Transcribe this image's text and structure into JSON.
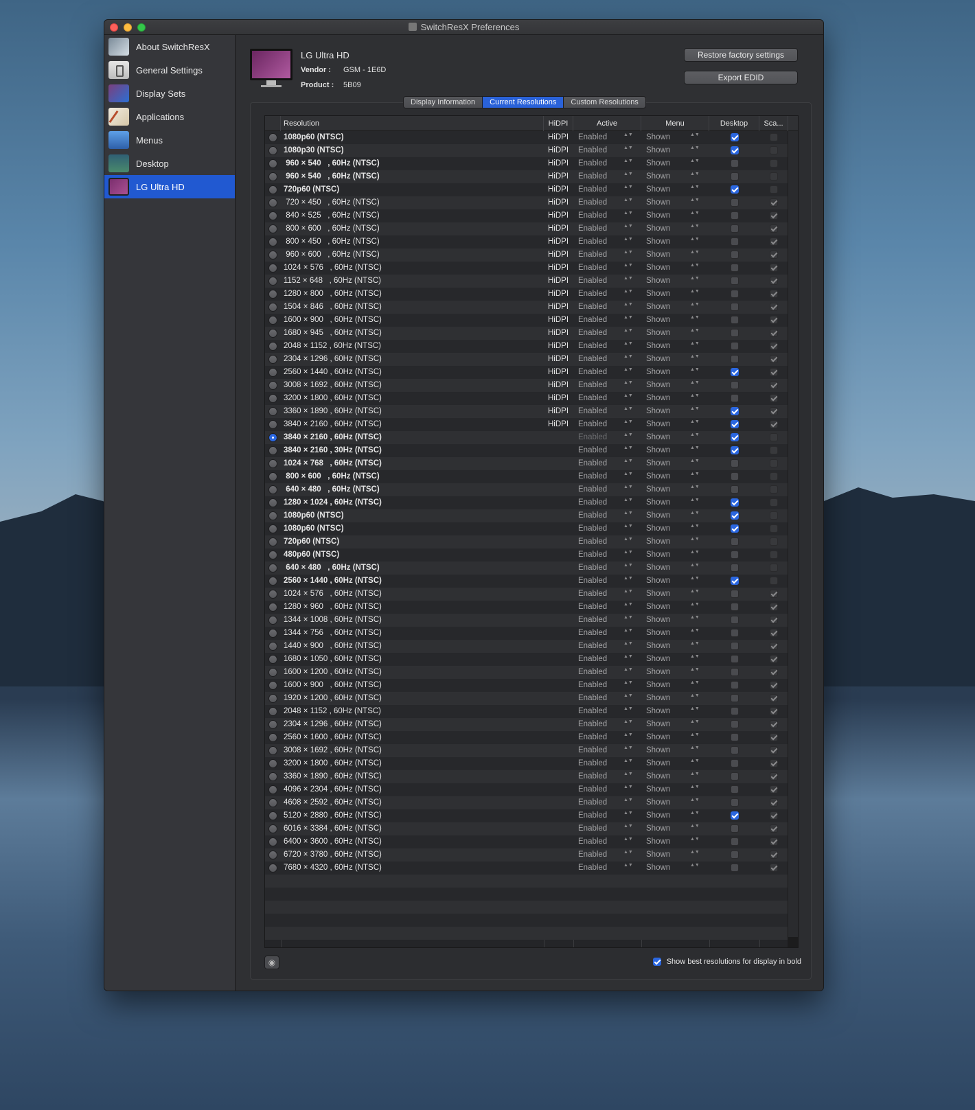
{
  "window": {
    "title": "SwitchResX Preferences"
  },
  "sidebar": {
    "items": [
      {
        "label": "About SwitchResX",
        "icon": "about-icon"
      },
      {
        "label": "General Settings",
        "icon": "general-settings-icon"
      },
      {
        "label": "Display Sets",
        "icon": "display-sets-icon"
      },
      {
        "label": "Applications",
        "icon": "applications-icon"
      },
      {
        "label": "Menus",
        "icon": "menus-icon"
      },
      {
        "label": "Desktop",
        "icon": "desktop-icon"
      },
      {
        "label": "LG Ultra HD",
        "icon": "lg-monitor-icon",
        "selected": true
      }
    ]
  },
  "display": {
    "name": "LG Ultra HD",
    "vendor_label": "Vendor :",
    "vendor": "GSM - 1E6D",
    "product_label": "Product :",
    "product": "5B09"
  },
  "buttons": {
    "restore": "Restore factory settings",
    "export": "Export EDID"
  },
  "tabs": [
    {
      "label": "Display Information",
      "active": false
    },
    {
      "label": "Current Resolutions",
      "active": true
    },
    {
      "label": "Custom Resolutions",
      "active": false
    }
  ],
  "table": {
    "headers": {
      "resolution": "Resolution",
      "hidpi": "HiDPI",
      "active": "Active",
      "menu": "Menu",
      "desktop": "Desktop",
      "scaled": "Sca..."
    },
    "rows": [
      {
        "res": "1080p60 (NTSC)",
        "bold": true,
        "hidpi": "HiDPI",
        "desktop": true,
        "scaled": false
      },
      {
        "res": "1080p30 (NTSC)",
        "bold": true,
        "hidpi": "HiDPI",
        "desktop": true,
        "scaled": false
      },
      {
        "res": " 960 × 540   , 60Hz (NTSC)",
        "bold": true,
        "hidpi": "HiDPI",
        "desktop": false,
        "scaled": false
      },
      {
        "res": " 960 × 540   , 60Hz (NTSC)",
        "bold": true,
        "hidpi": "HiDPI",
        "desktop": false,
        "scaled": false
      },
      {
        "res": "720p60 (NTSC)",
        "bold": true,
        "hidpi": "HiDPI",
        "desktop": true,
        "scaled": false
      },
      {
        "res": " 720 × 450   , 60Hz (NTSC)",
        "bold": false,
        "hidpi": "HiDPI",
        "desktop": false,
        "scaled": true
      },
      {
        "res": " 840 × 525   , 60Hz (NTSC)",
        "bold": false,
        "hidpi": "HiDPI",
        "desktop": false,
        "scaled": true
      },
      {
        "res": " 800 × 600   , 60Hz (NTSC)",
        "bold": false,
        "hidpi": "HiDPI",
        "desktop": false,
        "scaled": true
      },
      {
        "res": " 800 × 450   , 60Hz (NTSC)",
        "bold": false,
        "hidpi": "HiDPI",
        "desktop": false,
        "scaled": true
      },
      {
        "res": " 960 × 600   , 60Hz (NTSC)",
        "bold": false,
        "hidpi": "HiDPI",
        "desktop": false,
        "scaled": true
      },
      {
        "res": "1024 × 576   , 60Hz (NTSC)",
        "bold": false,
        "hidpi": "HiDPI",
        "desktop": false,
        "scaled": true
      },
      {
        "res": "1152 × 648   , 60Hz (NTSC)",
        "bold": false,
        "hidpi": "HiDPI",
        "desktop": false,
        "scaled": true
      },
      {
        "res": "1280 × 800   , 60Hz (NTSC)",
        "bold": false,
        "hidpi": "HiDPI",
        "desktop": false,
        "scaled": true
      },
      {
        "res": "1504 × 846   , 60Hz (NTSC)",
        "bold": false,
        "hidpi": "HiDPI",
        "desktop": false,
        "scaled": true
      },
      {
        "res": "1600 × 900   , 60Hz (NTSC)",
        "bold": false,
        "hidpi": "HiDPI",
        "desktop": false,
        "scaled": true
      },
      {
        "res": "1680 × 945   , 60Hz (NTSC)",
        "bold": false,
        "hidpi": "HiDPI",
        "desktop": false,
        "scaled": true
      },
      {
        "res": "2048 × 1152 , 60Hz (NTSC)",
        "bold": false,
        "hidpi": "HiDPI",
        "desktop": false,
        "scaled": true
      },
      {
        "res": "2304 × 1296 , 60Hz (NTSC)",
        "bold": false,
        "hidpi": "HiDPI",
        "desktop": false,
        "scaled": true
      },
      {
        "res": "2560 × 1440 , 60Hz (NTSC)",
        "bold": false,
        "hidpi": "HiDPI",
        "desktop": true,
        "scaled": true
      },
      {
        "res": "3008 × 1692 , 60Hz (NTSC)",
        "bold": false,
        "hidpi": "HiDPI",
        "desktop": false,
        "scaled": true
      },
      {
        "res": "3200 × 1800 , 60Hz (NTSC)",
        "bold": false,
        "hidpi": "HiDPI",
        "desktop": false,
        "scaled": true
      },
      {
        "res": "3360 × 1890 , 60Hz (NTSC)",
        "bold": false,
        "hidpi": "HiDPI",
        "desktop": true,
        "scaled": true
      },
      {
        "res": "3840 × 2160 , 60Hz (NTSC)",
        "bold": false,
        "hidpi": "HiDPI",
        "desktop": true,
        "scaled": true
      },
      {
        "res": "3840 × 2160 , 60Hz (NTSC)",
        "bold": true,
        "hidpi": "",
        "desktop": true,
        "scaled": false,
        "current": true
      },
      {
        "res": "3840 × 2160 , 30Hz (NTSC)",
        "bold": true,
        "hidpi": "",
        "desktop": true,
        "scaled": false
      },
      {
        "res": "1024 × 768   , 60Hz (NTSC)",
        "bold": true,
        "hidpi": "",
        "desktop": false,
        "scaled": false
      },
      {
        "res": " 800 × 600   , 60Hz (NTSC)",
        "bold": true,
        "hidpi": "",
        "desktop": false,
        "scaled": false
      },
      {
        "res": " 640 × 480   , 60Hz (NTSC)",
        "bold": true,
        "hidpi": "",
        "desktop": false,
        "scaled": false
      },
      {
        "res": "1280 × 1024 , 60Hz (NTSC)",
        "bold": true,
        "hidpi": "",
        "desktop": true,
        "scaled": false
      },
      {
        "res": "1080p60 (NTSC)",
        "bold": true,
        "hidpi": "",
        "desktop": true,
        "scaled": false
      },
      {
        "res": "1080p60 (NTSC)",
        "bold": true,
        "hidpi": "",
        "desktop": true,
        "scaled": false
      },
      {
        "res": "720p60 (NTSC)",
        "bold": true,
        "hidpi": "",
        "desktop": false,
        "scaled": false
      },
      {
        "res": "480p60 (NTSC)",
        "bold": true,
        "hidpi": "",
        "desktop": false,
        "scaled": false
      },
      {
        "res": " 640 × 480   , 60Hz (NTSC)",
        "bold": true,
        "hidpi": "",
        "desktop": false,
        "scaled": false
      },
      {
        "res": "2560 × 1440 , 60Hz (NTSC)",
        "bold": true,
        "hidpi": "",
        "desktop": true,
        "scaled": false
      },
      {
        "res": "1024 × 576   , 60Hz (NTSC)",
        "bold": false,
        "hidpi": "",
        "desktop": false,
        "scaled": true
      },
      {
        "res": "1280 × 960   , 60Hz (NTSC)",
        "bold": false,
        "hidpi": "",
        "desktop": false,
        "scaled": true
      },
      {
        "res": "1344 × 1008 , 60Hz (NTSC)",
        "bold": false,
        "hidpi": "",
        "desktop": false,
        "scaled": true
      },
      {
        "res": "1344 × 756   , 60Hz (NTSC)",
        "bold": false,
        "hidpi": "",
        "desktop": false,
        "scaled": true
      },
      {
        "res": "1440 × 900   , 60Hz (NTSC)",
        "bold": false,
        "hidpi": "",
        "desktop": false,
        "scaled": true
      },
      {
        "res": "1680 × 1050 , 60Hz (NTSC)",
        "bold": false,
        "hidpi": "",
        "desktop": false,
        "scaled": true
      },
      {
        "res": "1600 × 1200 , 60Hz (NTSC)",
        "bold": false,
        "hidpi": "",
        "desktop": false,
        "scaled": true
      },
      {
        "res": "1600 × 900   , 60Hz (NTSC)",
        "bold": false,
        "hidpi": "",
        "desktop": false,
        "scaled": true
      },
      {
        "res": "1920 × 1200 , 60Hz (NTSC)",
        "bold": false,
        "hidpi": "",
        "desktop": false,
        "scaled": true
      },
      {
        "res": "2048 × 1152 , 60Hz (NTSC)",
        "bold": false,
        "hidpi": "",
        "desktop": false,
        "scaled": true
      },
      {
        "res": "2304 × 1296 , 60Hz (NTSC)",
        "bold": false,
        "hidpi": "",
        "desktop": false,
        "scaled": true
      },
      {
        "res": "2560 × 1600 , 60Hz (NTSC)",
        "bold": false,
        "hidpi": "",
        "desktop": false,
        "scaled": true
      },
      {
        "res": "3008 × 1692 , 60Hz (NTSC)",
        "bold": false,
        "hidpi": "",
        "desktop": false,
        "scaled": true
      },
      {
        "res": "3200 × 1800 , 60Hz (NTSC)",
        "bold": false,
        "hidpi": "",
        "desktop": false,
        "scaled": true
      },
      {
        "res": "3360 × 1890 , 60Hz (NTSC)",
        "bold": false,
        "hidpi": "",
        "desktop": false,
        "scaled": true
      },
      {
        "res": "4096 × 2304 , 60Hz (NTSC)",
        "bold": false,
        "hidpi": "",
        "desktop": false,
        "scaled": true
      },
      {
        "res": "4608 × 2592 , 60Hz (NTSC)",
        "bold": false,
        "hidpi": "",
        "desktop": false,
        "scaled": true
      },
      {
        "res": "5120 × 2880 , 60Hz (NTSC)",
        "bold": false,
        "hidpi": "",
        "desktop": true,
        "scaled": true
      },
      {
        "res": "6016 × 3384 , 60Hz (NTSC)",
        "bold": false,
        "hidpi": "",
        "desktop": false,
        "scaled": true
      },
      {
        "res": "6400 × 3600 , 60Hz (NTSC)",
        "bold": false,
        "hidpi": "",
        "desktop": false,
        "scaled": true
      },
      {
        "res": "6720 × 3780 , 60Hz (NTSC)",
        "bold": false,
        "hidpi": "",
        "desktop": false,
        "scaled": true
      },
      {
        "res": "7680 × 4320 , 60Hz (NTSC)",
        "bold": false,
        "hidpi": "",
        "desktop": false,
        "scaled": true
      }
    ],
    "active_value": "Enabled",
    "menu_value": "Shown"
  },
  "footer": {
    "bold_option": "Show best resolutions for display in bold",
    "bold_checked": true,
    "eye_icon": "eye-icon"
  }
}
